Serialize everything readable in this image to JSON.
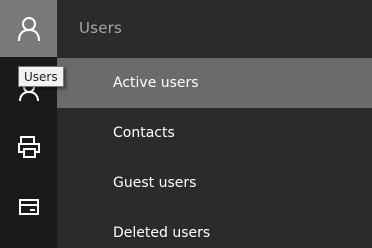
{
  "rail": {
    "items": [
      {
        "icon": "user-icon",
        "active": true
      },
      {
        "icon": "user-icon",
        "active": false
      },
      {
        "icon": "print-icon",
        "active": false
      },
      {
        "icon": "card-icon",
        "active": false
      }
    ]
  },
  "tooltip": {
    "text": "Users"
  },
  "panel": {
    "title": "Users",
    "items": [
      {
        "label": "Active users",
        "selected": true
      },
      {
        "label": "Contacts",
        "selected": false
      },
      {
        "label": "Guest users",
        "selected": false
      },
      {
        "label": "Deleted users",
        "selected": false
      }
    ]
  },
  "colors": {
    "rail_bg": "#1a1a1a",
    "panel_bg": "#2b2b2b",
    "active_rail": "#7a7a7a",
    "selected_item": "#6b6b6b"
  }
}
